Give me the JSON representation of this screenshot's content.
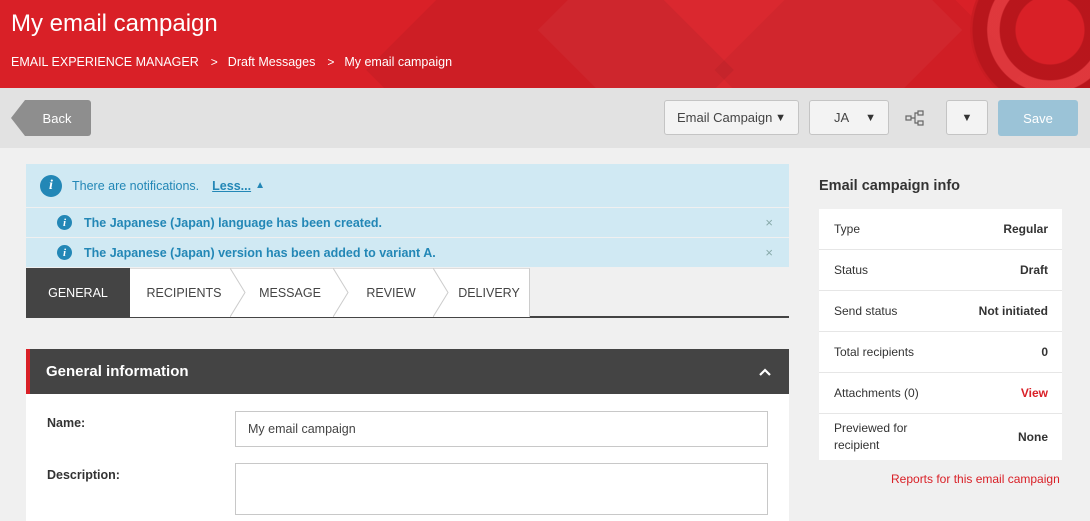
{
  "header": {
    "title": "My email campaign",
    "breadcrumb": [
      "EMAIL EXPERIENCE MANAGER",
      "Draft Messages",
      "My email campaign"
    ],
    "breadcrumb_separator": ">"
  },
  "toolbar": {
    "back_label": "Back",
    "campaign_dropdown": "Email Campaign",
    "language_dropdown": "JA",
    "save_label": "Save"
  },
  "notifications": {
    "summary": "There are notifications.",
    "toggle_label": "Less...",
    "items": [
      "The Japanese (Japan) language has been created.",
      "The Japanese (Japan) version has been added to variant A."
    ],
    "close_glyph": "×"
  },
  "tabs": [
    "GENERAL",
    "RECIPIENTS",
    "MESSAGE",
    "REVIEW",
    "DELIVERY"
  ],
  "active_tab": "GENERAL",
  "general": {
    "title": "General information",
    "name_label": "Name:",
    "name_value": "My email campaign",
    "description_label": "Description:",
    "description_value": ""
  },
  "info": {
    "title": "Email campaign info",
    "rows": [
      {
        "label": "Type",
        "value": "Regular"
      },
      {
        "label": "Status",
        "value": "Draft"
      },
      {
        "label": "Send status",
        "value": "Not initiated"
      },
      {
        "label": "Total recipients",
        "value": "0"
      },
      {
        "label": "Attachments (0)",
        "value": "View"
      },
      {
        "label": "Previewed for recipient",
        "value": "None"
      }
    ],
    "reports_link": "Reports for this email campaign"
  },
  "colors": {
    "brand_red": "#d92027",
    "dark_gray": "#444444",
    "info_blue": "#2387b6",
    "notification_bg": "#d0e9f3",
    "save_disabled": "#9bc3d7"
  }
}
